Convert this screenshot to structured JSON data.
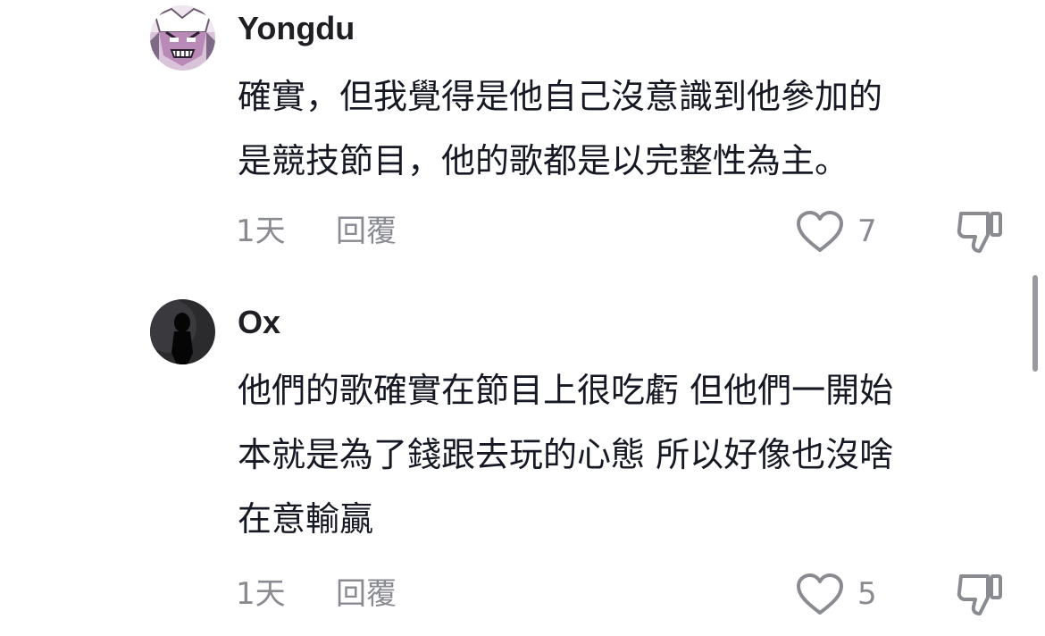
{
  "comments": [
    {
      "username": "Yongdu",
      "avatar": "anime-character-avatar",
      "lines": [
        "確實，但我覺得是他自己沒意識到他參加的",
        "是競技節目，他的歌都是以完整性為主。"
      ],
      "time": "1天",
      "reply_label": "回覆",
      "like_count": "7",
      "like_icon": "heart-outline-icon",
      "dislike_icon": "thumbs-down-icon"
    },
    {
      "username": "Ox",
      "avatar": "silhouette-avatar",
      "lines": [
        "他們的歌確實在節目上很吃虧 但他們一開始",
        "本就是為了錢跟去玩的心態 所以好像也沒啥",
        "在意輸贏"
      ],
      "time": "1天",
      "reply_label": "回覆",
      "like_count": "5",
      "like_icon": "heart-outline-icon",
      "dislike_icon": "thumbs-down-icon"
    }
  ],
  "colors": {
    "text": "#161823",
    "secondary": "#8a8b91",
    "background": "#ffffff"
  }
}
